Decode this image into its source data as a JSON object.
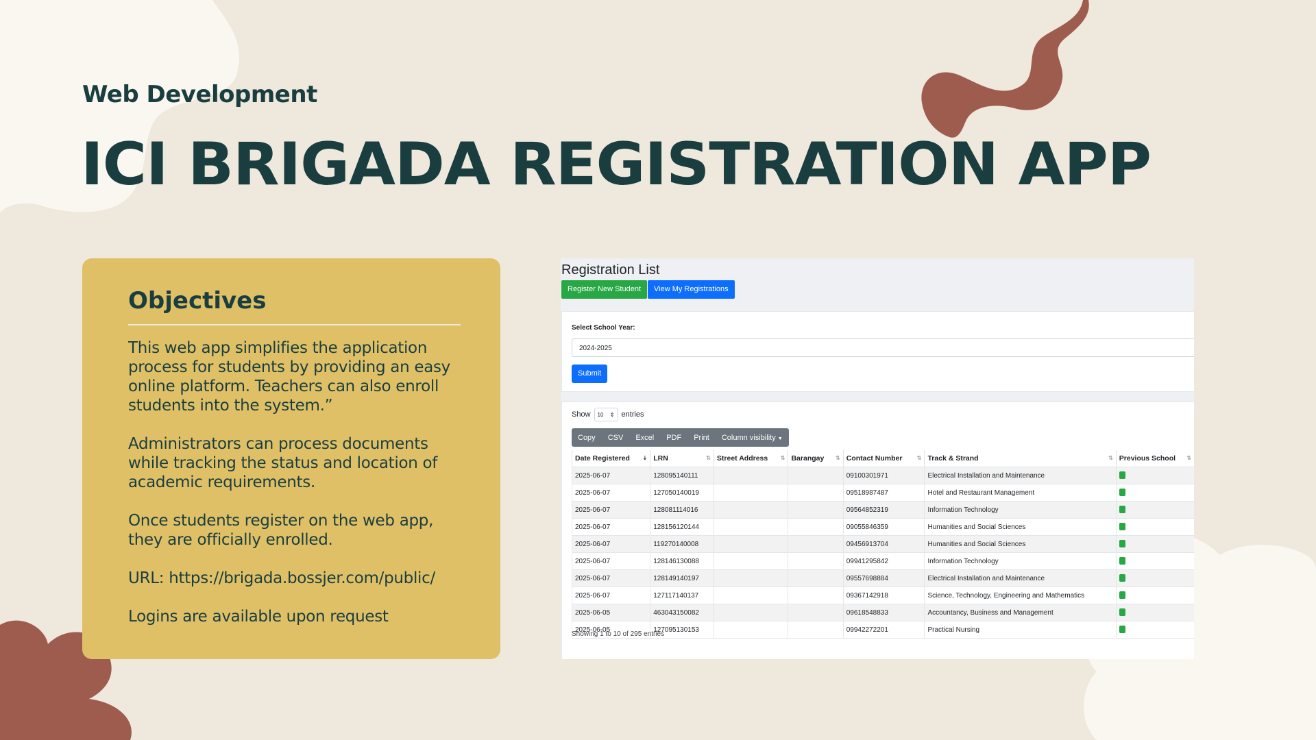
{
  "slide": {
    "subtitle": "Web Development",
    "title": "ICI BRIGADA REGISTRATION APP",
    "colors": {
      "background": "#efe8dc",
      "heading": "#1a3e3f",
      "card": "#dfc067",
      "accent_shape": "#9e5c4f"
    }
  },
  "objectives": {
    "heading": "Objectives",
    "paragraphs": [
      "This web app simplifies the application process for students by providing an easy online platform. Teachers can also enroll students into the system.”",
      "Administrators can process documents while tracking the status and location of academic requirements.",
      "Once students register on the web app, they are officially enrolled.",
      "URL: https://brigada.bossjer.com/public/",
      "Logins are available upon request"
    ]
  },
  "app": {
    "page_title": "Registration List",
    "register_button": "Register New Student",
    "view_button": "View My Registrations",
    "school_year_label": "Select School Year:",
    "school_year_value": "2024-2025",
    "submit_button": "Submit",
    "show_label": "Show",
    "show_value": "10",
    "entries_label": "entries",
    "export_buttons": [
      "Copy",
      "CSV",
      "Excel",
      "PDF",
      "Print",
      "Column visibility"
    ],
    "columns": [
      "Date Registered",
      "LRN",
      "Street Address",
      "Barangay",
      "Contact Number",
      "Track & Strand",
      "Previous School"
    ],
    "rows": [
      [
        "2025-06-07",
        "128095140111",
        "",
        "",
        "09100301971",
        "Electrical Installation and Maintenance"
      ],
      [
        "2025-06-07",
        "127050140019",
        "",
        "",
        "09518987487",
        "Hotel and Restaurant Management"
      ],
      [
        "2025-06-07",
        "128081114016",
        "",
        "",
        "09564852319",
        "Information Technology"
      ],
      [
        "2025-06-07",
        "128156120144",
        "",
        "",
        "09055846359",
        "Humanities and Social Sciences"
      ],
      [
        "2025-06-07",
        "119270140008",
        "",
        "",
        "09456913704",
        "Humanities and Social Sciences"
      ],
      [
        "2025-06-07",
        "128146130088",
        "",
        "",
        "09941295842",
        "Information Technology"
      ],
      [
        "2025-06-07",
        "128149140197",
        "",
        "",
        "09557698884",
        "Electrical Installation and Maintenance"
      ],
      [
        "2025-06-07",
        "127117140137",
        "",
        "",
        "09367142918",
        "Science, Technology, Engineering and Mathematics"
      ],
      [
        "2025-06-05",
        "463043150082",
        "",
        "",
        "09618548833",
        "Accountancy, Business and Management"
      ],
      [
        "2025-06-05",
        "127095130153",
        "",
        "",
        "09942272201",
        "Practical Nursing"
      ]
    ],
    "footer": "Showing 1 to 10 of 295 entries"
  }
}
